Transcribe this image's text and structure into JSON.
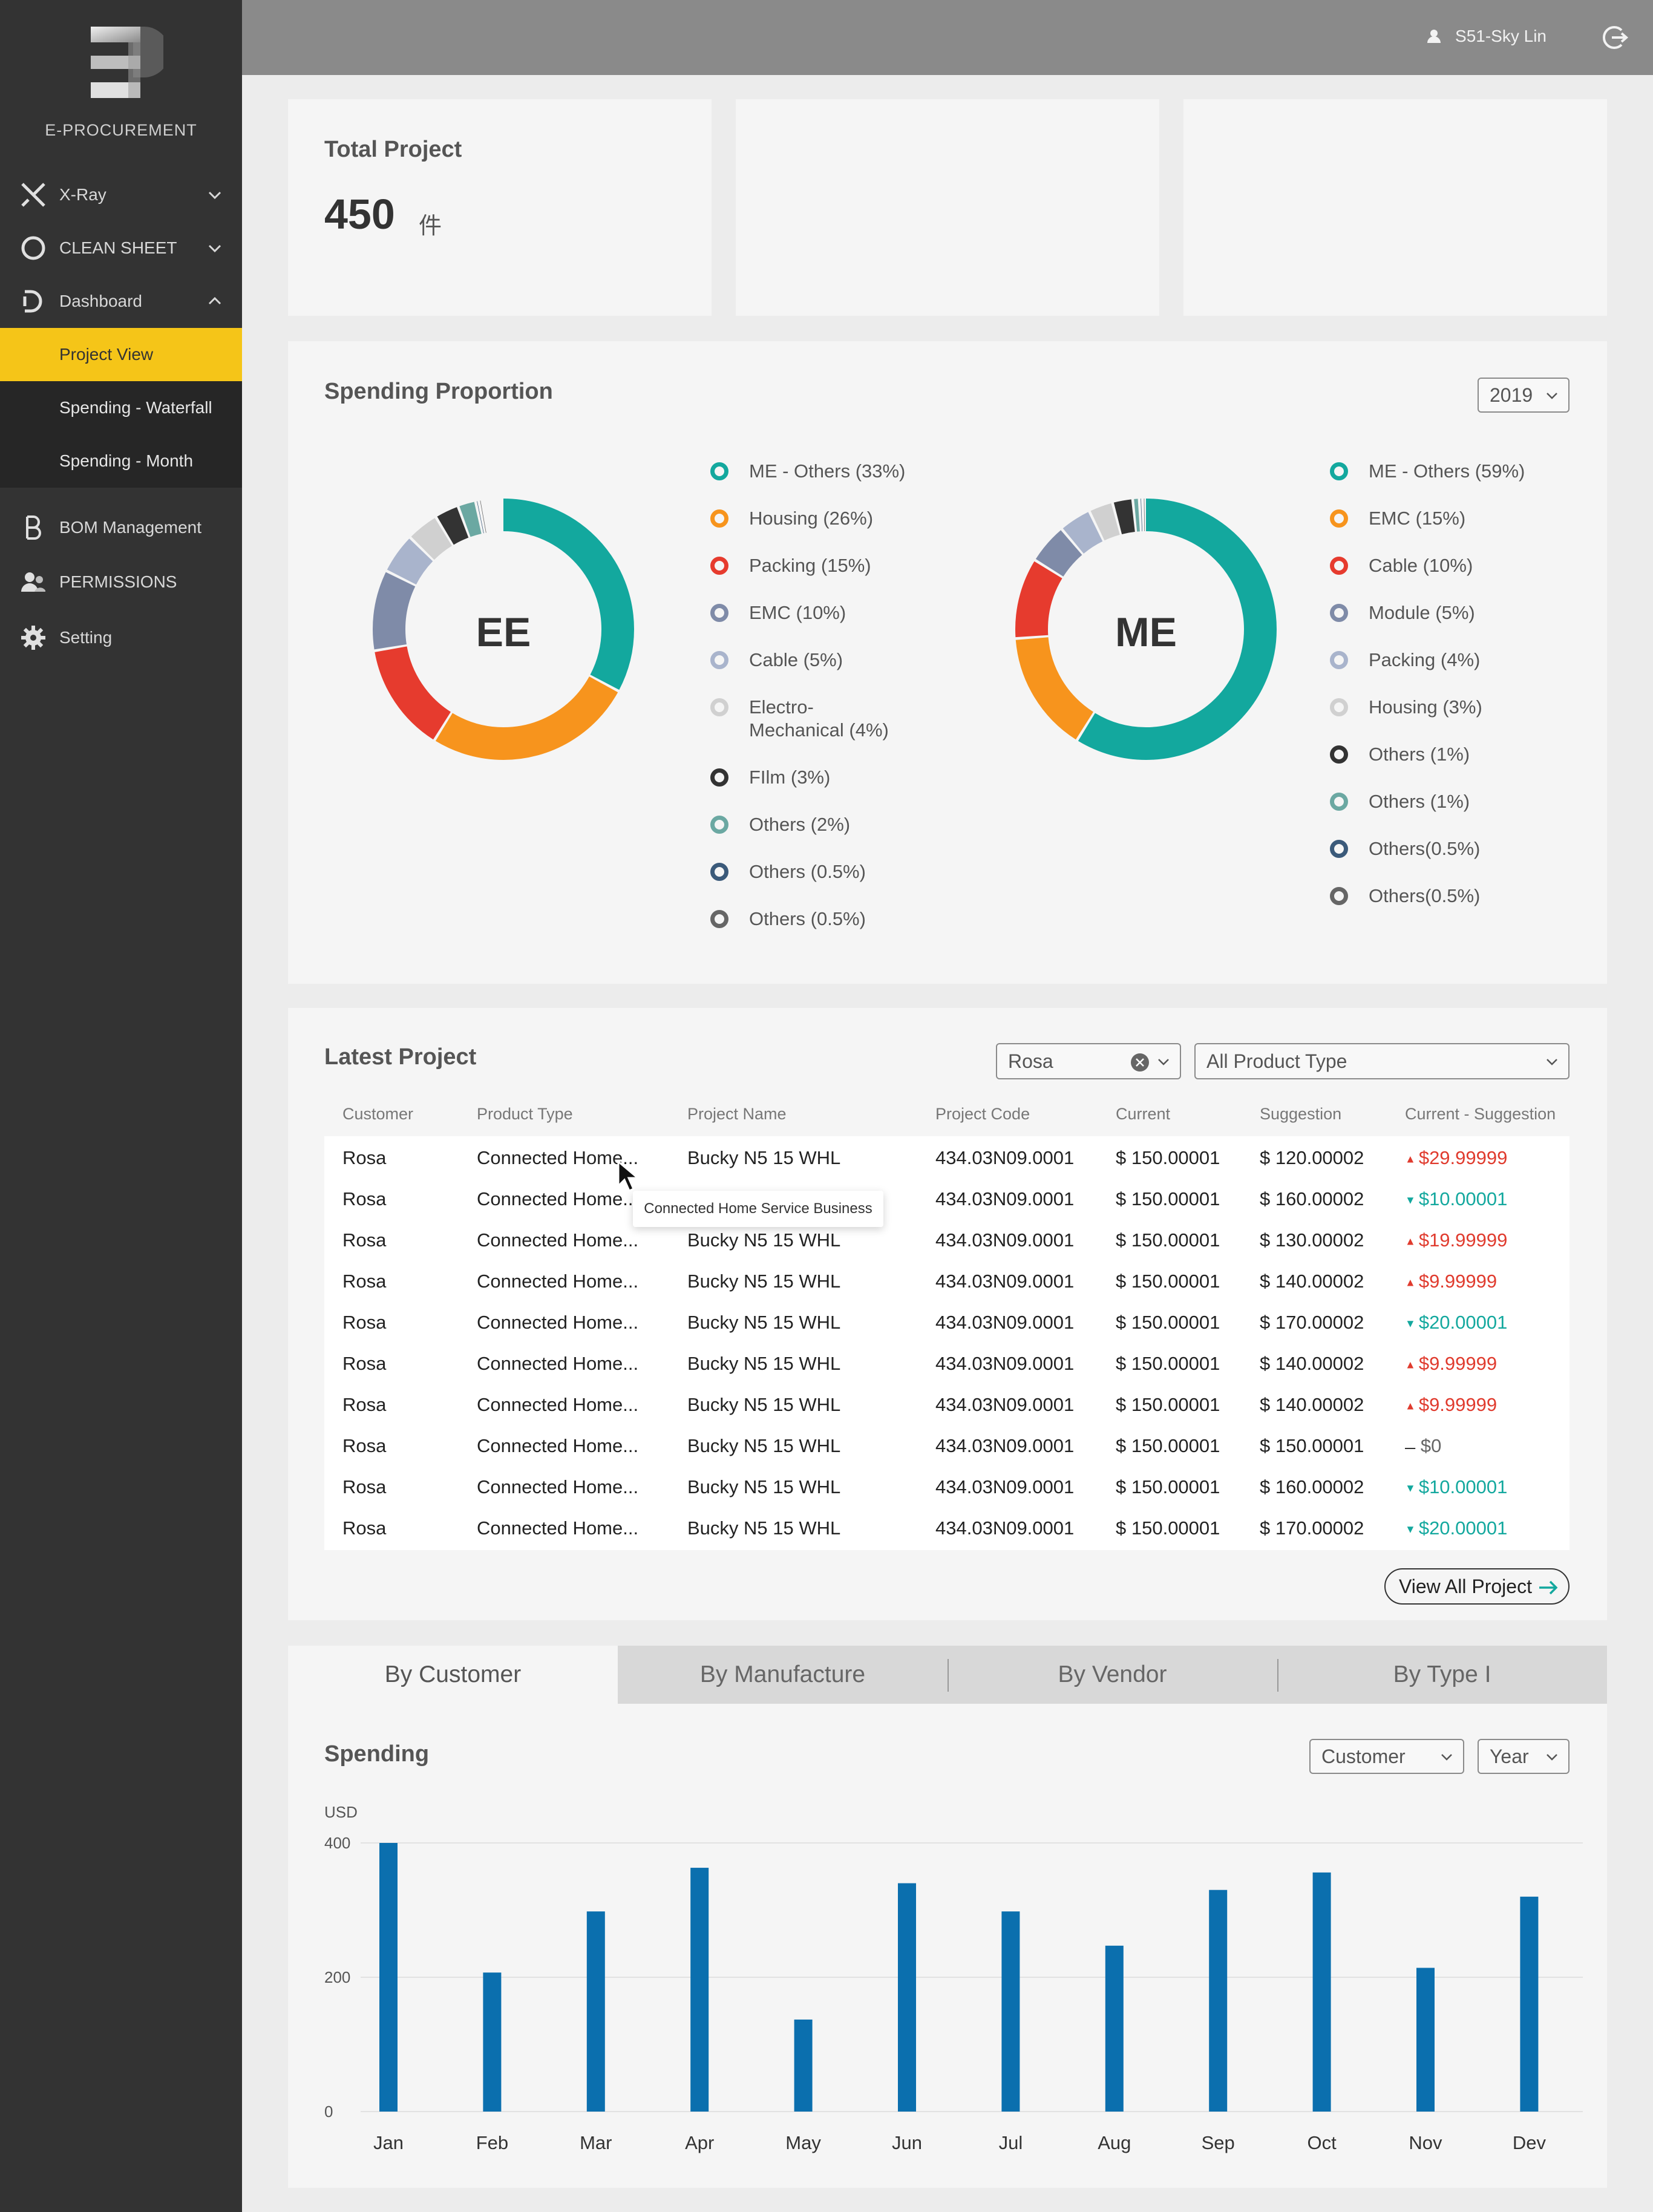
{
  "app": {
    "logo_text": "E-PROCUREMENT"
  },
  "user": {
    "name": "S51-Sky Lin"
  },
  "sidebar": {
    "items": [
      {
        "label": "X-Ray",
        "icon": "xray-icon",
        "expanded": false
      },
      {
        "label": "CLEAN SHEET",
        "icon": "circle-icon",
        "expanded": false
      },
      {
        "label": "Dashboard",
        "icon": "dashboard-icon",
        "expanded": true
      },
      {
        "label": "BOM Management",
        "icon": "bom-icon"
      },
      {
        "label": "PERMISSIONS",
        "icon": "permissions-icon"
      },
      {
        "label": "Setting",
        "icon": "gear-icon"
      }
    ],
    "dashboard_sub": [
      {
        "label": "Project View",
        "active": true
      },
      {
        "label": "Spending - Waterfall",
        "active": false
      },
      {
        "label": "Spending - Month",
        "active": false
      }
    ]
  },
  "kpi": {
    "title": "Total Project",
    "value": "450",
    "unit": "件"
  },
  "spending_proportion": {
    "title": "Spending Proportion",
    "year": "2019",
    "ee": {
      "label": "EE",
      "legend": [
        {
          "label": "ME - Others (33%)",
          "color": "#13a89e"
        },
        {
          "label": "Housing (26%)",
          "color": "#f7941d"
        },
        {
          "label": "Packing (15%)",
          "color": "#e63b2e"
        },
        {
          "label": "EMC (10%)",
          "color": "#7f8ba8"
        },
        {
          "label": "Cable (5%)",
          "color": "#a9b4cc"
        },
        {
          "label": "Electro-",
          "label2": "Mechanical (4%)",
          "color": "#d0d0d0"
        },
        {
          "label": "FIlm (3%)",
          "color": "#333333"
        },
        {
          "label": "Others (2%)",
          "color": "#6ba8a2"
        },
        {
          "label": "Others (0.5%)",
          "color": "#3b5a7a"
        },
        {
          "label": "Others (0.5%)",
          "color": "#666666"
        }
      ]
    },
    "me": {
      "label": "ME",
      "legend": [
        {
          "label": "ME - Others (59%)",
          "color": "#13a89e"
        },
        {
          "label": "EMC (15%)",
          "color": "#f7941d"
        },
        {
          "label": "Cable (10%)",
          "color": "#e63b2e"
        },
        {
          "label": "Module (5%)",
          "color": "#7f8ba8"
        },
        {
          "label": "Packing (4%)",
          "color": "#a9b4cc"
        },
        {
          "label": "Housing (3%)",
          "color": "#d0d0d0"
        },
        {
          "label": "Others (1%)",
          "color": "#333333"
        },
        {
          "label": "Others (1%)",
          "color": "#6ba8a2"
        },
        {
          "label": "Others(0.5%)",
          "color": "#3b5a7a"
        },
        {
          "label": "Others(0.5%)",
          "color": "#666666"
        }
      ]
    }
  },
  "latest_project": {
    "title": "Latest Project",
    "customer_filter": "Rosa",
    "product_type_filter": "All Product Type",
    "columns": [
      "Customer",
      "Product Type",
      "Project Name",
      "Project Code",
      "Current",
      "Suggestion",
      "Current - Suggestion"
    ],
    "rows": [
      {
        "customer": "Rosa",
        "product_type": "Connected Home...",
        "project_name": "Bucky N5 15 WHL",
        "code": "434.03N09.0001",
        "current": "$ 150.00001",
        "suggestion": "$ 120.00002",
        "diff": "$29.99999",
        "trend": "up"
      },
      {
        "customer": "Rosa",
        "product_type": "Connected Home...",
        "project_name": "Bucky N5 15 WHL",
        "code": "434.03N09.0001",
        "current": "$ 150.00001",
        "suggestion": "$ 160.00002",
        "diff": "$10.00001",
        "trend": "down"
      },
      {
        "customer": "Rosa",
        "product_type": "Connected Home...",
        "project_name": "Bucky N5 15 WHL",
        "code": "434.03N09.0001",
        "current": "$ 150.00001",
        "suggestion": "$ 130.00002",
        "diff": "$19.99999",
        "trend": "up"
      },
      {
        "customer": "Rosa",
        "product_type": "Connected Home...",
        "project_name": "Bucky N5 15 WHL",
        "code": "434.03N09.0001",
        "current": "$ 150.00001",
        "suggestion": "$ 140.00002",
        "diff": "$9.99999",
        "trend": "up"
      },
      {
        "customer": "Rosa",
        "product_type": "Connected Home...",
        "project_name": "Bucky N5 15 WHL",
        "code": "434.03N09.0001",
        "current": "$ 150.00001",
        "suggestion": "$ 170.00002",
        "diff": "$20.00001",
        "trend": "down"
      },
      {
        "customer": "Rosa",
        "product_type": "Connected Home...",
        "project_name": "Bucky N5 15 WHL",
        "code": "434.03N09.0001",
        "current": "$ 150.00001",
        "suggestion": "$ 140.00002",
        "diff": "$9.99999",
        "trend": "up"
      },
      {
        "customer": "Rosa",
        "product_type": "Connected Home...",
        "project_name": "Bucky N5 15 WHL",
        "code": "434.03N09.0001",
        "current": "$ 150.00001",
        "suggestion": "$ 140.00002",
        "diff": "$9.99999",
        "trend": "up"
      },
      {
        "customer": "Rosa",
        "product_type": "Connected Home...",
        "project_name": "Bucky N5 15 WHL",
        "code": "434.03N09.0001",
        "current": "$ 150.00001",
        "suggestion": "$ 150.00001",
        "diff": "$0",
        "trend": "zero"
      },
      {
        "customer": "Rosa",
        "product_type": "Connected Home...",
        "project_name": "Bucky N5 15 WHL",
        "code": "434.03N09.0001",
        "current": "$ 150.00001",
        "suggestion": "$ 160.00002",
        "diff": "$10.00001",
        "trend": "down"
      },
      {
        "customer": "Rosa",
        "product_type": "Connected Home...",
        "project_name": "Bucky N5 15 WHL",
        "code": "434.03N09.0001",
        "current": "$ 150.00001",
        "suggestion": "$ 170.00002",
        "diff": "$20.00001",
        "trend": "down"
      }
    ],
    "tooltip": "Connected Home Service Business",
    "view_all": "View All Project"
  },
  "tabs": [
    "By Customer",
    "By Manufacture",
    "By Vendor",
    "By Type I"
  ],
  "spending": {
    "title": "Spending",
    "group_by": "Customer",
    "period": "Year"
  },
  "chart_data": {
    "type": "bar",
    "categories": [
      "Jan",
      "Feb",
      "Mar",
      "Apr",
      "May",
      "Jun",
      "Jul",
      "Aug",
      "Sep",
      "Oct",
      "Nov",
      "Dev"
    ],
    "values": [
      400,
      207,
      298,
      363,
      137,
      340,
      298,
      247,
      330,
      356,
      214,
      320
    ],
    "ylabel": "USD",
    "yticks": [
      0,
      200,
      400
    ],
    "ylim": [
      0,
      400
    ],
    "color": "#0b6fae",
    "grid": true
  }
}
